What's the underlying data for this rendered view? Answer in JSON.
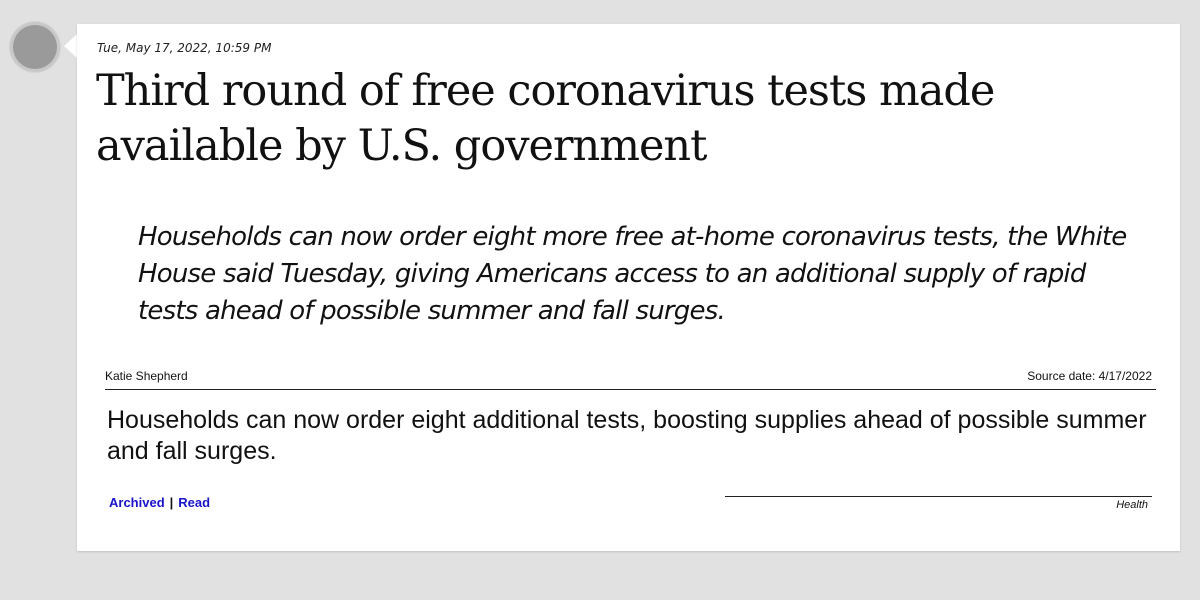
{
  "post": {
    "timestamp": "Tue, May 17, 2022, 10:59 PM",
    "headline": "Third round of free coronavirus tests made available by U.S. government",
    "dek": "Households can now order eight more free at-home coronavirus tests, the White House said Tuesday, giving Americans access to an additional supply of rapid tests ahead of possible summer and fall surges.",
    "author": "Katie Shepherd",
    "source_date": "Source date: 4/17/2022",
    "summary": "Households can now order eight additional tests, boosting supplies ahead of possible summer and fall surges.",
    "links": {
      "archived_label": "Archived",
      "separator": "|",
      "read_label": "Read"
    },
    "category": "Health"
  },
  "colors": {
    "background": "#e1e1e1",
    "card": "#ffffff",
    "link": "#1a14c9",
    "avatar": "#9a9a9a"
  },
  "icons": {
    "avatar": "avatar-circle"
  }
}
